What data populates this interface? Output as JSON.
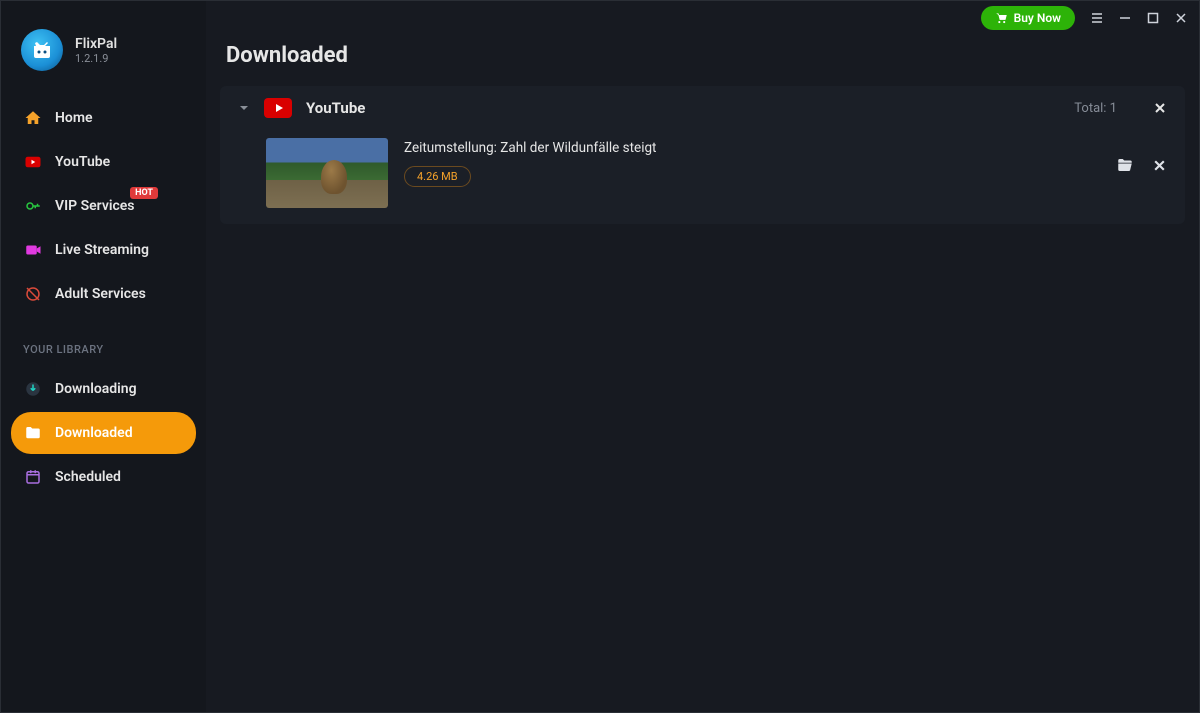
{
  "brand": {
    "name": "FlixPal",
    "version": "1.2.1.9"
  },
  "titlebar": {
    "buy_label": "Buy Now"
  },
  "page": {
    "title": "Downloaded"
  },
  "nav": {
    "items": [
      {
        "label": "Home"
      },
      {
        "label": "YouTube"
      },
      {
        "label": "VIP Services",
        "badge": "HOT"
      },
      {
        "label": "Live Streaming"
      },
      {
        "label": "Adult Services"
      }
    ],
    "library_label": "YOUR LIBRARY",
    "library": [
      {
        "label": "Downloading"
      },
      {
        "label": "Downloaded",
        "active": true
      },
      {
        "label": "Scheduled"
      }
    ]
  },
  "group": {
    "name": "YouTube",
    "total_label": "Total: 1",
    "items": [
      {
        "title": "Zeitumstellung: Zahl der Wildunfälle steigt",
        "size": "4.26 MB"
      }
    ]
  }
}
